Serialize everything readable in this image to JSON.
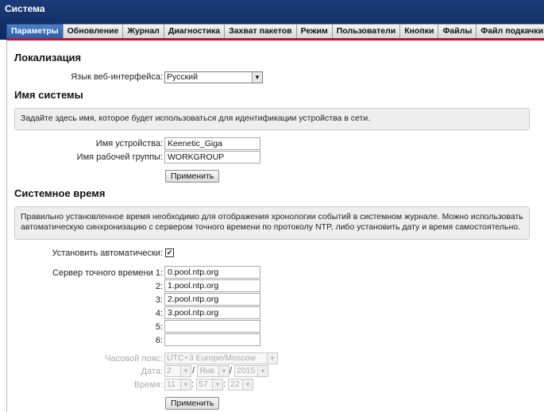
{
  "window": {
    "title": "Система"
  },
  "tabs": [
    {
      "label": "Параметры",
      "active": true
    },
    {
      "label": "Обновление"
    },
    {
      "label": "Журнал"
    },
    {
      "label": "Диагностика"
    },
    {
      "label": "Захват пакетов"
    },
    {
      "label": "Режим"
    },
    {
      "label": "Пользователи"
    },
    {
      "label": "Кнопки"
    },
    {
      "label": "Файлы"
    },
    {
      "label": "Файл подкачки"
    }
  ],
  "localization": {
    "heading": "Локализация",
    "language_label": "Язык веб-интерфейса:",
    "language_value": "Русский"
  },
  "system_name": {
    "heading": "Имя системы",
    "note": "Задайте здесь имя, которое будет использоваться для идентификации устройства в сети.",
    "device_label": "Имя устройства:",
    "device_value": "Keenetic_Giga",
    "workgroup_label": "Имя рабочей группы:",
    "workgroup_value": "WORKGROUP",
    "apply_label": "Применить"
  },
  "system_time": {
    "heading": "Системное время",
    "note": "Правильно установленное время необходимо для отображения хронологии событий в системном журнале. Можно использовать автоматическую синхронизацию с сервером точного времени по протоколу NTP, либо установить дату и время самостоятельно.",
    "auto_label": "Установить автоматически:",
    "auto_checked": true,
    "check_mark": "✔",
    "ntp_label": "Сервер точного времени 1:",
    "ntp_labels": [
      "2:",
      "3:",
      "4:",
      "5:",
      "6:"
    ],
    "ntp_servers": [
      "0.pool.ntp.org",
      "1.pool.ntp.org",
      "2.pool.ntp.org",
      "3.pool.ntp.org",
      "",
      ""
    ],
    "timezone_label": "Часовой пояс:",
    "timezone_value": "UTC+3 Europe/Moscow",
    "date_label": "Дата:",
    "date_day": "2",
    "date_month": "Янв",
    "date_year": "2015",
    "date_sep": "/",
    "time_label": "Время:",
    "time_hour": "11",
    "time_min": "57",
    "time_sec": "22",
    "time_sep": ":",
    "apply_label": "Применить"
  },
  "icons": {
    "dropdown": "▼"
  }
}
